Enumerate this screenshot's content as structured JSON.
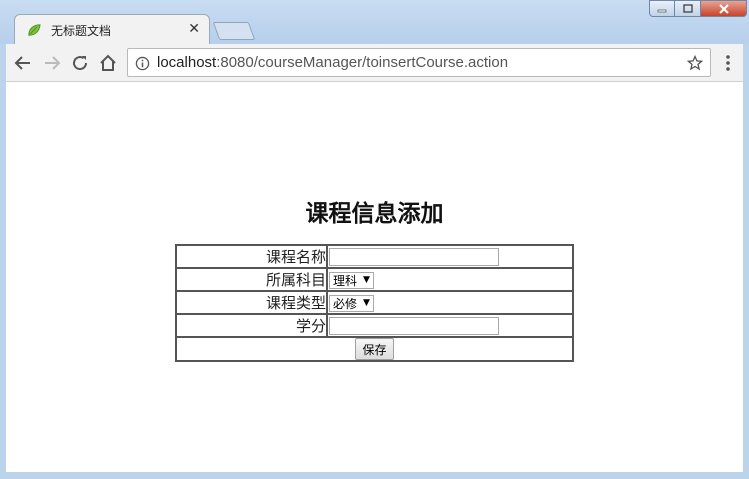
{
  "tab": {
    "title": "无标题文档",
    "favicon": "leaf-icon"
  },
  "address_bar": {
    "host": "localhost",
    "path": ":8080/courseManager/toinsertCourse.action"
  },
  "page": {
    "title": "课程信息添加",
    "fields": {
      "course_name_label": "课程名称",
      "course_name_value": "",
      "subject_label": "所属科目",
      "subject_selected": "理科",
      "course_type_label": "课程类型",
      "course_type_selected": "必修",
      "credit_label": "学分",
      "credit_value": ""
    },
    "save_label": "保存"
  },
  "colors": {
    "chrome": "#bcd3ec",
    "toolbar": "#f2f2f2",
    "table_border": "#555555"
  }
}
